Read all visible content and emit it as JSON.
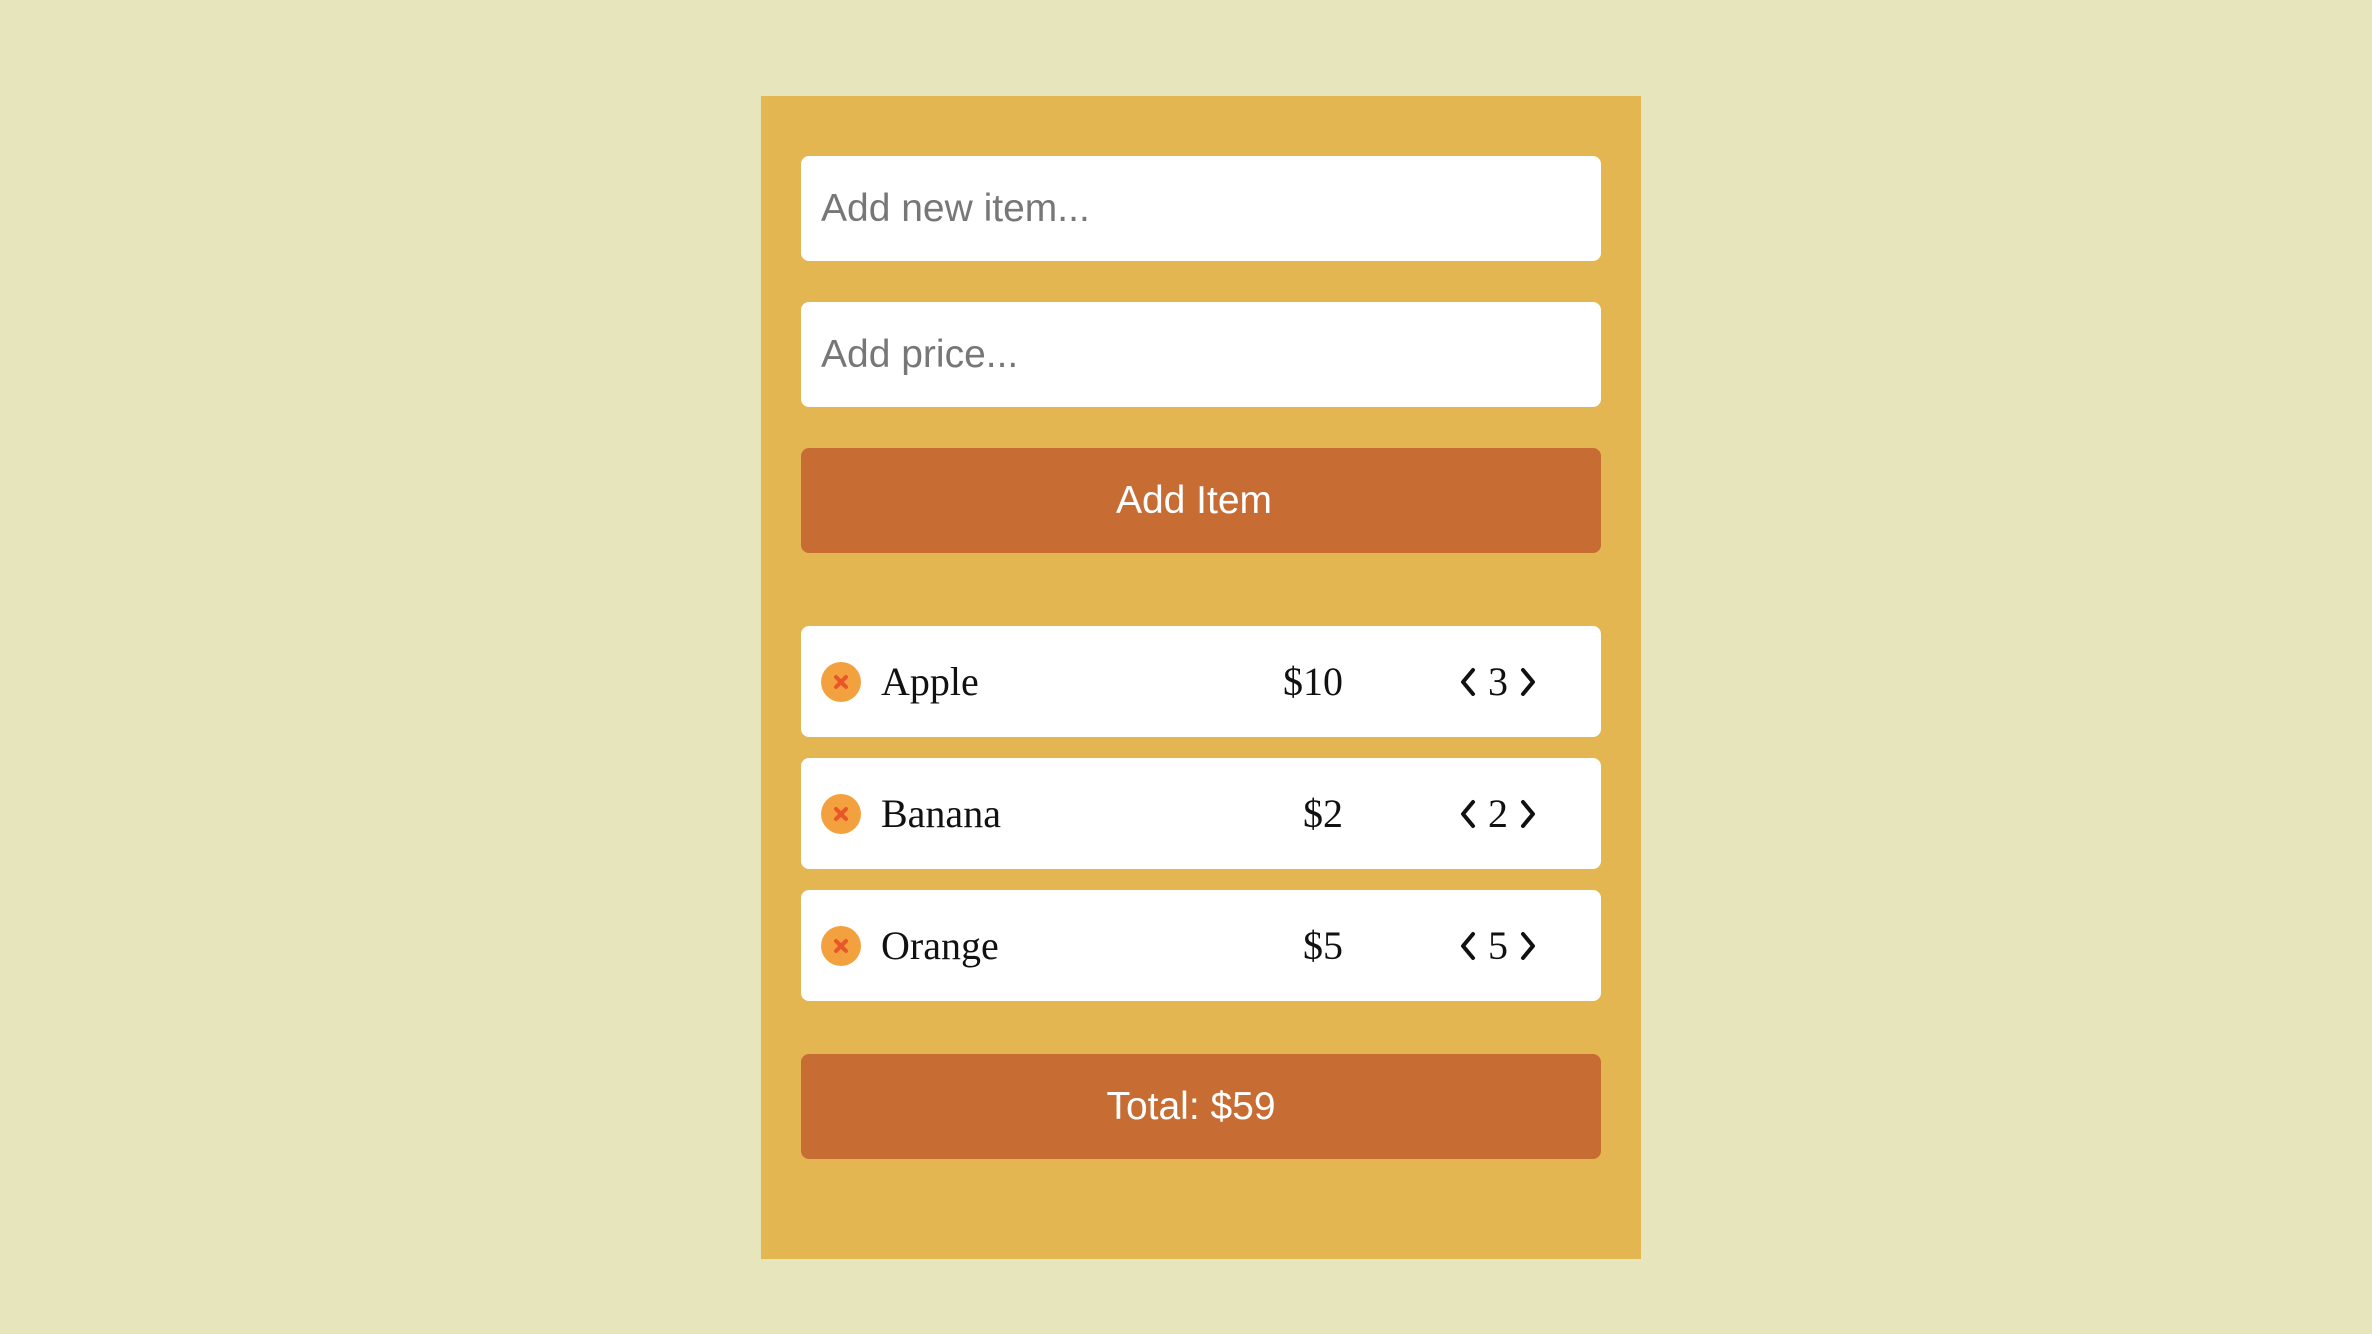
{
  "form": {
    "name_placeholder": "Add new item...",
    "price_placeholder": "Add price...",
    "add_button_label": "Add Item"
  },
  "icons": {
    "remove": "close-circle-icon",
    "decrease": "chevron-left-icon",
    "increase": "chevron-right-icon"
  },
  "colors": {
    "background": "#e6e5bb",
    "panel": "#e4b651",
    "button": "#c76d34",
    "remove_icon_fill": "#f3a13e",
    "remove_icon_mark": "#e8562a"
  },
  "items": [
    {
      "name": "Apple",
      "price": "$10",
      "quantity": "3"
    },
    {
      "name": "Banana",
      "price": "$2",
      "quantity": "2"
    },
    {
      "name": "Orange",
      "price": "$5",
      "quantity": "5"
    }
  ],
  "total_label": "Total: $59"
}
